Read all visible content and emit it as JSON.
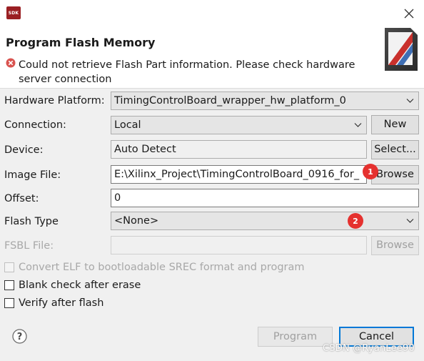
{
  "window": {
    "app_icon_text": "SDK",
    "close_glyph": "×"
  },
  "header": {
    "title": "Program Flash Memory",
    "error_message": "Could not retrieve Flash Part information. Please check hardware server connection"
  },
  "form": {
    "hardware_platform": {
      "label": "Hardware Platform:",
      "value": "TimingControlBoard_wrapper_hw_platform_0"
    },
    "connection": {
      "label": "Connection:",
      "value": "Local",
      "new_button": "New"
    },
    "device": {
      "label": "Device:",
      "value": "Auto Detect",
      "select_button": "Select..."
    },
    "image_file": {
      "label": "Image File:",
      "value": "E:\\Xilinx_Project\\TimingControlBoard_0916_for_",
      "browse_button": "Browse"
    },
    "offset": {
      "label": "Offset:",
      "value": "0"
    },
    "flash_type": {
      "label": "Flash Type",
      "value": "<None>"
    },
    "fsbl_file": {
      "label": "FSBL File:",
      "value": "",
      "browse_button": "Browse"
    }
  },
  "options": {
    "convert_elf": {
      "label": "Convert ELF to bootloadable SREC format and program",
      "checked": false,
      "enabled": false
    },
    "blank_check": {
      "label": "Blank check after erase",
      "checked": false,
      "enabled": true
    },
    "verify": {
      "label": "Verify after flash",
      "checked": false,
      "enabled": true
    }
  },
  "footer": {
    "help_glyph": "?",
    "program_button": "Program",
    "cancel_button": "Cancel"
  },
  "annotations": {
    "marker_1": "1",
    "marker_2": "2"
  },
  "watermark": "CSDN @RyanLee90",
  "colors": {
    "error_red": "#d9534f",
    "marker_red": "#e5312f",
    "focus_blue": "#0078d7",
    "app_icon_red": "#9a1f23"
  }
}
